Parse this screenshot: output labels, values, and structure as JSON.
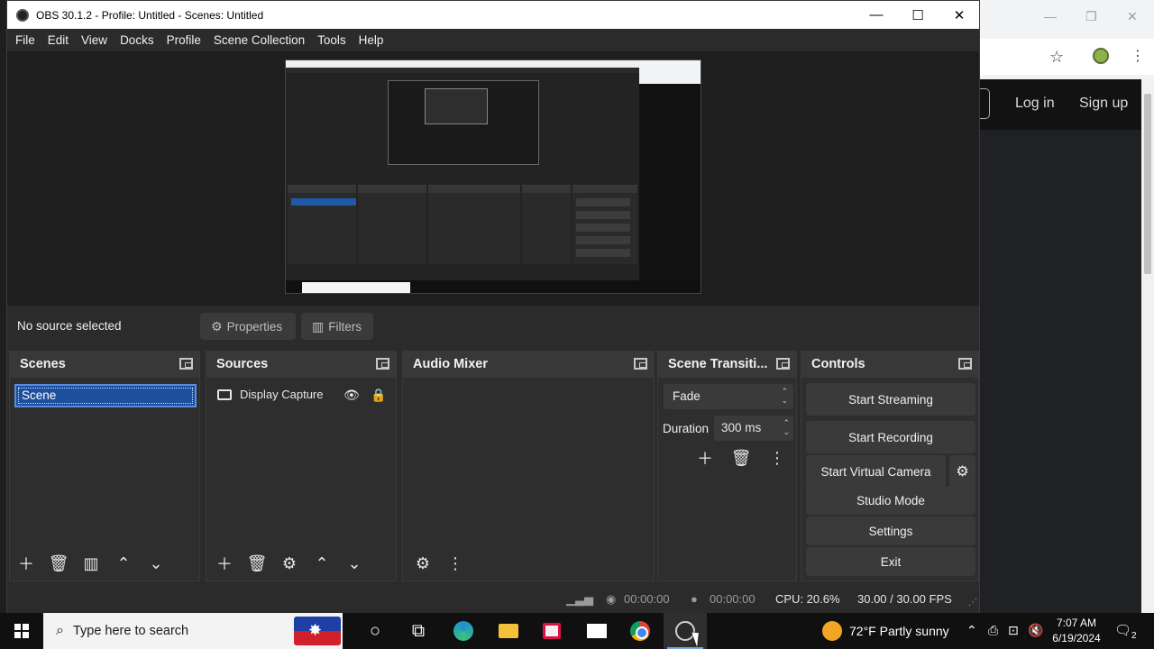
{
  "browser": {
    "login_label": "Log in",
    "signup_label": "Sign up"
  },
  "window": {
    "title": "OBS 30.1.2 - Profile: Untitled - Scenes: Untitled",
    "minimize": "—",
    "maximize": "☐",
    "close": "✕"
  },
  "menu": [
    "File",
    "Edit",
    "View",
    "Docks",
    "Profile",
    "Scene Collection",
    "Tools",
    "Help"
  ],
  "source_bar": {
    "status": "No source selected",
    "properties_label": "Properties",
    "filters_label": "Filters"
  },
  "docks": {
    "scenes": {
      "title": "Scenes",
      "items": [
        "Scene"
      ]
    },
    "sources": {
      "title": "Sources",
      "items": [
        {
          "label": "Display Capture",
          "visible": true,
          "locked": true
        }
      ]
    },
    "audio_mixer": {
      "title": "Audio Mixer"
    },
    "transitions": {
      "title": "Scene Transiti...",
      "transition": "Fade",
      "duration_label": "Duration",
      "duration_value": "300 ms"
    },
    "controls": {
      "title": "Controls",
      "start_streaming": "Start Streaming",
      "start_recording": "Start Recording",
      "start_virtual_camera": "Start Virtual Camera",
      "studio_mode": "Studio Mode",
      "settings": "Settings",
      "exit": "Exit"
    }
  },
  "status_bar": {
    "stream_time": "00:00:00",
    "record_time": "00:00:00",
    "cpu": "CPU: 20.6%",
    "fps": "30.00 / 30.00 FPS"
  },
  "taskbar": {
    "search_placeholder": "Type here to search",
    "weather": "72°F  Partly sunny",
    "time": "7:07 AM",
    "date": "6/19/2024",
    "notification_count": "2"
  }
}
